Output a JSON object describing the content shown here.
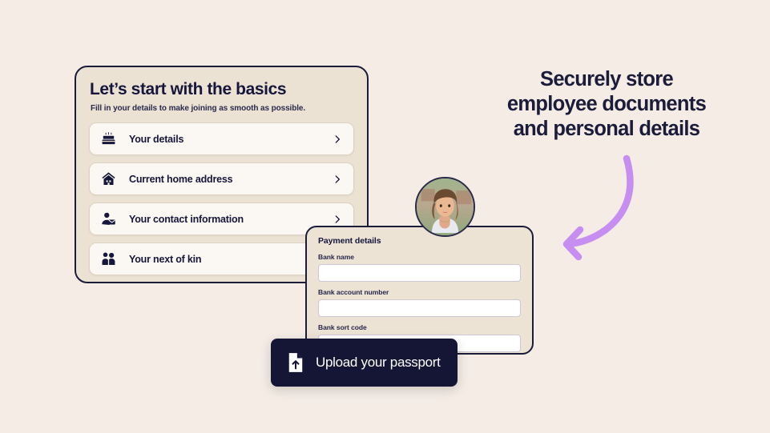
{
  "theme": {
    "page_background": "#f4ece5",
    "card_background": "#ebe2d4",
    "row_background": "#fbf8f3",
    "ink": "#16163a",
    "accent_arrow": "#c78ef2",
    "pill_background": "#151536"
  },
  "basics_card": {
    "title": "Let’s start with the basics",
    "subtitle": "Fill in your details to make joining as smooth as possible.",
    "rows": [
      {
        "label": "Your details",
        "icon": "birthday-cake-icon",
        "chevron": "›"
      },
      {
        "label": "Current home address",
        "icon": "house-icon",
        "chevron": "›"
      },
      {
        "label": "Your contact information",
        "icon": "person-envelope-icon",
        "chevron": "›"
      },
      {
        "label": "Your next of kin",
        "icon": "two-people-icon",
        "chevron": "›"
      }
    ]
  },
  "headline": {
    "line1": "Securely store",
    "line2": "employee documents",
    "line3": "and personal details"
  },
  "payment_card": {
    "title": "Payment details",
    "fields": [
      {
        "label": "Bank name",
        "value": "",
        "placeholder": ""
      },
      {
        "label": "Bank account number",
        "value": "",
        "placeholder": ""
      },
      {
        "label": "Bank sort code",
        "value": "",
        "placeholder": ""
      }
    ]
  },
  "upload_pill": {
    "label": "Upload your passport",
    "icon": "document-upload-icon"
  },
  "avatar": {
    "alt": "employee-profile-photo"
  },
  "arrow": {
    "name": "curved-pointer-arrow",
    "color": "#c78ef2"
  }
}
